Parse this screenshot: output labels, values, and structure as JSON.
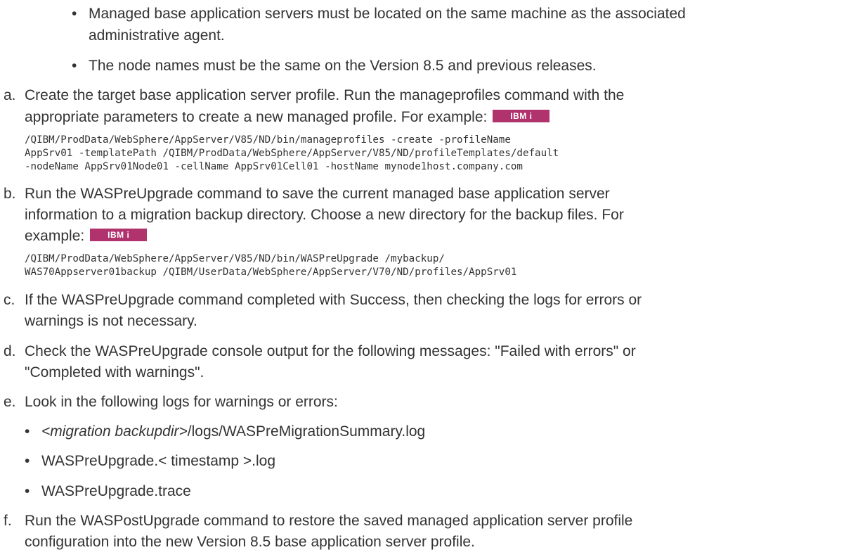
{
  "top_bullets": [
    "Managed base application servers must be located on the same machine as the associated administrative agent.",
    "The node names must be the same on the Version 8.5 and previous releases."
  ],
  "top_bullet_1_line1": "Managed base application servers must be located on the same machine as the associated",
  "top_bullet_1_line2": "administrative agent.",
  "platform_badge": "IBM i",
  "steps": {
    "a": {
      "letter": "a.",
      "line1": "Create the target base application server profile. Run the manageprofiles command with the",
      "line2": "appropriate parameters to create a new managed profile. For example:",
      "code": [
        "/QIBM/ProdData/WebSphere/AppServer/V85/ND/bin/manageprofiles -create -profileName",
        "AppSrv01 -templatePath /QIBM/ProdData/WebSphere/AppServer/V85/ND/profileTemplates/default",
        "-nodeName AppSrv01Node01 -cellName AppSrv01Cell01 -hostName mynode1host.company.com"
      ]
    },
    "b": {
      "letter": "b.",
      "line1": "Run the WASPreUpgrade command to save the current managed base application server",
      "line2": "information to a migration backup directory. Choose a new directory for the backup files. For",
      "line3": "example:",
      "code": [
        "/QIBM/ProdData/WebSphere/AppServer/V85/ND/bin/WASPreUpgrade /mybackup/",
        "WAS70Appserver01backup /QIBM/UserData/WebSphere/AppServer/V70/ND/profiles/AppSrv01"
      ]
    },
    "c": {
      "letter": "c.",
      "line1": "If the WASPreUpgrade command completed with Success, then checking the logs for errors or",
      "line2": "warnings is not necessary."
    },
    "d": {
      "letter": "d.",
      "line1": "Check the WASPreUpgrade console output for the following messages: \"Failed with errors\" or",
      "line2": "\"Completed with warnings\"."
    },
    "e": {
      "letter": "e.",
      "line1": "Look in the following logs for warnings or errors:",
      "log_1_em": "<migration backupdir>",
      "log_1_rest": "/logs/WASPreMigrationSummary.log",
      "log_2": "WASPreUpgrade.< timestamp >.log",
      "log_3": "WASPreUpgrade.trace"
    },
    "f": {
      "letter": "f.",
      "line1": "Run the WASPostUpgrade command to restore the saved managed application server profile",
      "line2": "configuration into the new Version 8.5 base application server profile."
    }
  }
}
